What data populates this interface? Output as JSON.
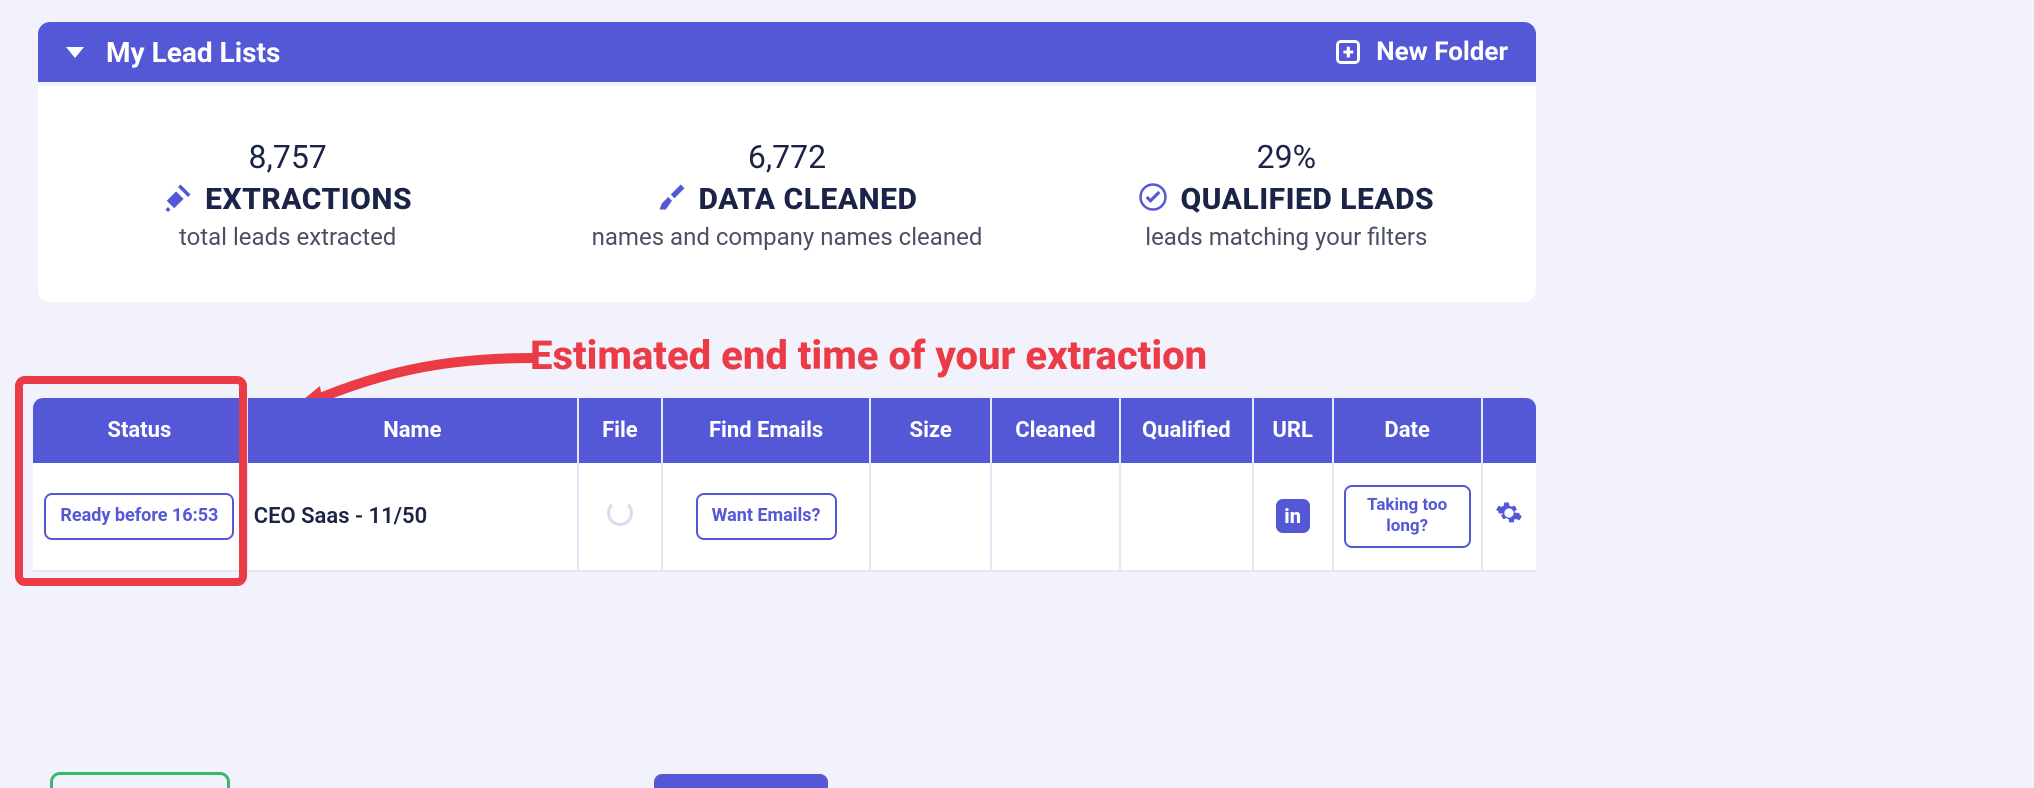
{
  "header": {
    "title": "My Lead Lists",
    "new_folder_label": "New Folder"
  },
  "stats": {
    "extractions": {
      "value": "8,757",
      "label": "EXTRACTIONS",
      "sub": "total leads extracted"
    },
    "cleaned": {
      "value": "6,772",
      "label": "DATA CLEANED",
      "sub": "names and company names cleaned"
    },
    "qualified": {
      "value": "29%",
      "label": "QUALIFIED LEADS",
      "sub": "leads matching your filters"
    }
  },
  "annotation": {
    "text": "Estimated end time of your extraction"
  },
  "table": {
    "columns": {
      "status": "Status",
      "name": "Name",
      "file": "File",
      "find_emails": "Find Emails",
      "size": "Size",
      "cleaned": "Cleaned",
      "qualified": "Qualified",
      "url": "URL",
      "date": "Date"
    },
    "rows": [
      {
        "status": "Ready before 16:53",
        "name": "CEO Saas - 11/50",
        "file": "loading",
        "find_emails": "Want Emails?",
        "size": "",
        "cleaned": "",
        "qualified": "",
        "url": "linkedin",
        "date": "Taking too long?"
      }
    ]
  },
  "colors": {
    "brand": "#5558d6",
    "annotation": "#eb3b46",
    "text_dark": "#1b2446",
    "success": "#3bb76b"
  }
}
